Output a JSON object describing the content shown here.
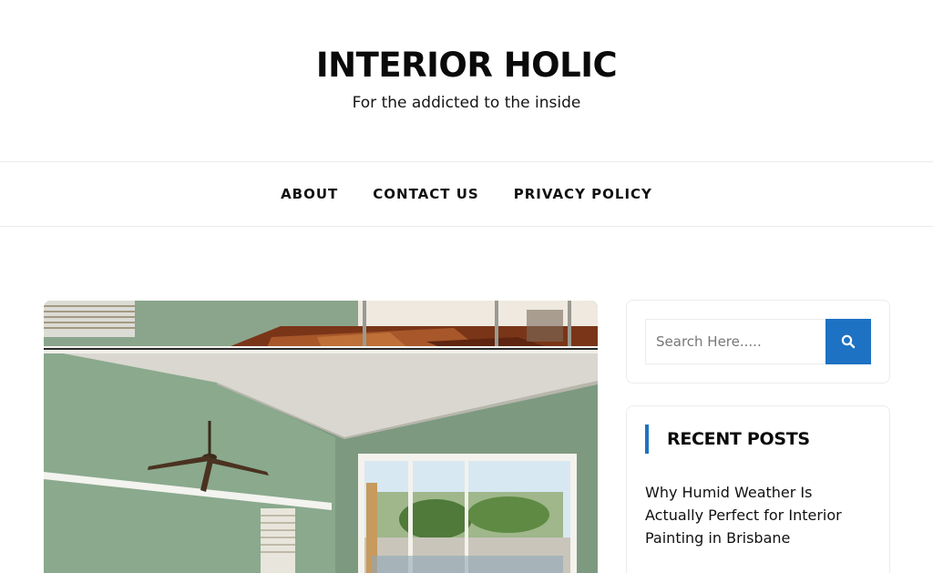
{
  "site": {
    "title": "INTERIOR HOLIC",
    "tagline": "For the addicted to the inside"
  },
  "nav": {
    "items": [
      {
        "label": "ABOUT"
      },
      {
        "label": "CONTACT US"
      },
      {
        "label": "PRIVACY POLICY"
      }
    ]
  },
  "search": {
    "placeholder": "Search Here.....",
    "button_icon": "search-icon"
  },
  "sidebar": {
    "recent_posts": {
      "title": "RECENT POSTS",
      "posts": [
        {
          "title": "Why Humid Weather Is Actually Perfect for Interior Painting in Brisbane"
        }
      ]
    }
  },
  "colors": {
    "accent": "#1e72c3",
    "wall_green": "#7d9a80",
    "floor_wood": "#8a3f1c"
  }
}
